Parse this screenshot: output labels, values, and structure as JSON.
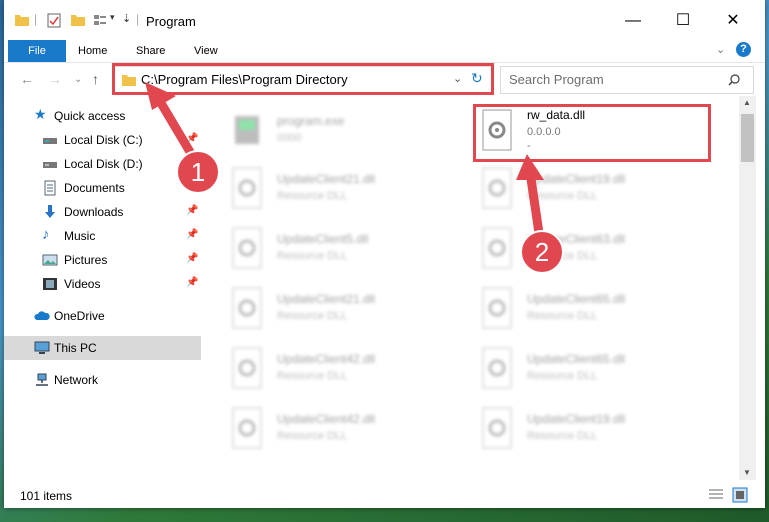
{
  "window": {
    "title": "Program"
  },
  "ribbon": {
    "tabs": [
      "File",
      "Home",
      "Share",
      "View"
    ]
  },
  "nav": {
    "address": "C:\\Program Files\\Program Directory",
    "search_placeholder": "Search Program"
  },
  "sidebar": {
    "items": [
      {
        "label": "Quick access",
        "icon": "star-icon",
        "pinned": false
      },
      {
        "label": "Local Disk (C:)",
        "icon": "drive-icon",
        "pinned": true
      },
      {
        "label": "Local Disk (D:)",
        "icon": "drive-icon",
        "pinned": true
      },
      {
        "label": "Documents",
        "icon": "documents-icon",
        "pinned": true
      },
      {
        "label": "Downloads",
        "icon": "download-icon",
        "pinned": true
      },
      {
        "label": "Music",
        "icon": "music-icon",
        "pinned": true
      },
      {
        "label": "Pictures",
        "icon": "pictures-icon",
        "pinned": true
      },
      {
        "label": "Videos",
        "icon": "videos-icon",
        "pinned": true
      },
      {
        "label": "OneDrive",
        "icon": "cloud-icon",
        "pinned": false
      },
      {
        "label": "This PC",
        "icon": "pc-icon",
        "pinned": false
      },
      {
        "label": "Network",
        "icon": "network-icon",
        "pinned": false
      }
    ]
  },
  "files": {
    "highlight": {
      "name": "rw_data.dll",
      "version": "0.0.0.0",
      "extra": "-"
    },
    "items": [
      {
        "name": "program.exe",
        "sub": "0000"
      },
      {
        "name": "UpdateClient21.dll",
        "sub": "Resource DLL"
      },
      {
        "name": "UpdateClient19.dll",
        "sub": "Resource DLL"
      },
      {
        "name": "UpdateClient5.dll",
        "sub": "Resource DLL"
      },
      {
        "name": "UpdateClient63.dll",
        "sub": "Resource DLL"
      },
      {
        "name": "UpdateClient21.dll",
        "sub": "Resource DLL"
      },
      {
        "name": "UpdateClient65.dll",
        "sub": "Resource DLL"
      },
      {
        "name": "UpdateClient42.dll",
        "sub": "Resource DLL"
      },
      {
        "name": "UpdateClient65.dll",
        "sub": "Resource DLL"
      },
      {
        "name": "UpdateClient42.dll",
        "sub": "Resource DLL"
      },
      {
        "name": "UpdateClient19.dll",
        "sub": "Resource DLL"
      }
    ]
  },
  "status": {
    "count": "101 items"
  },
  "annotations": {
    "step1": "1",
    "step2": "2"
  },
  "colors": {
    "accent": "#1979ca",
    "annotation": "#e0474f"
  }
}
